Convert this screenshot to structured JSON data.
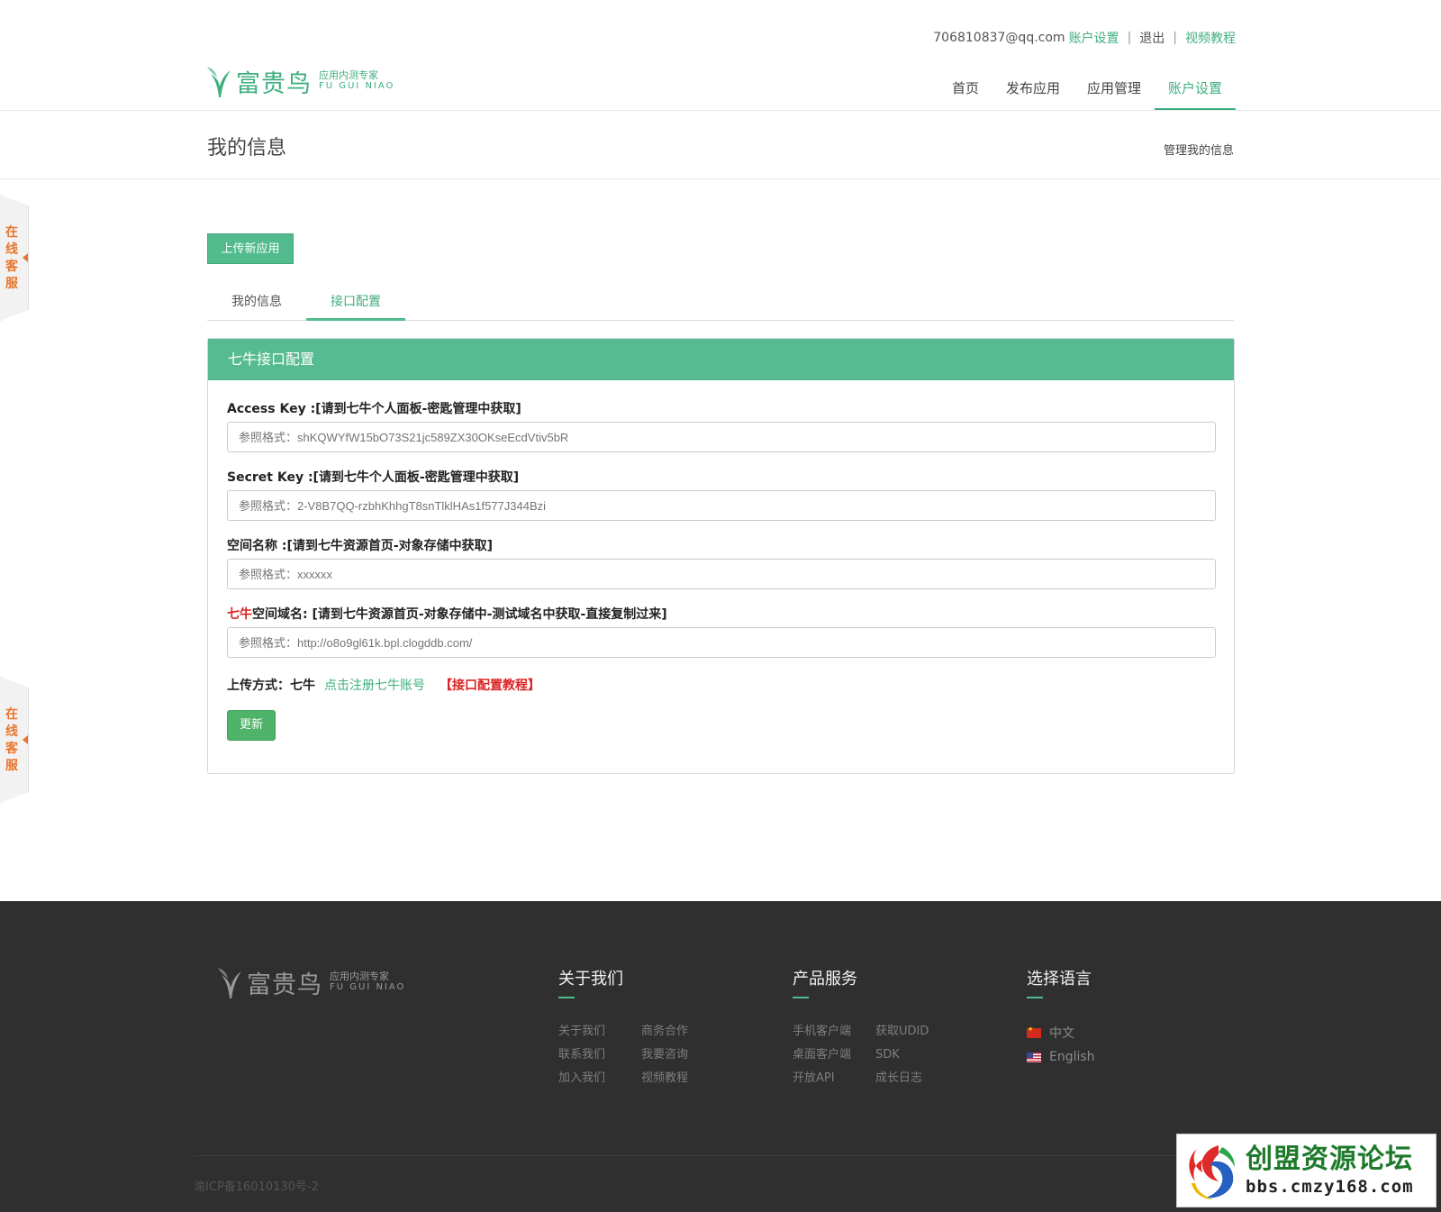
{
  "header": {
    "user_email": "706810837@qq.com",
    "account_settings_link": "账户设置",
    "logout_link": "退出",
    "video_tutorial_link": "视频教程",
    "separator": "|",
    "logo": {
      "name": "富贵鸟",
      "tagline_cn": "应用内测专家",
      "tagline_en": "FU GUI NIAO"
    },
    "nav": [
      "首页",
      "发布应用",
      "应用管理",
      "账户设置"
    ]
  },
  "page": {
    "title": "我的信息",
    "manage_link": "管理我的信息",
    "upload_button": "上传新应用",
    "tabs": [
      "我的信息",
      "接口配置"
    ],
    "active_tab": "接口配置"
  },
  "side_service": {
    "label": "在线客服"
  },
  "panel": {
    "title": "七牛接口配置",
    "fields": {
      "access_key": {
        "label": "Access Key :[请到七牛个人面板-密匙管理中获取]",
        "placeholder": "参照格式：shKQWYfW15bO73S21jc589ZX30OKseEcdVtiv5bR"
      },
      "secret_key": {
        "label": "Secret Key :[请到七牛个人面板-密匙管理中获取]",
        "placeholder": "参照格式：2-V8B7QQ-rzbhKhhgT8snTlklHAs1f577J344Bzi"
      },
      "bucket": {
        "label": "空间名称 :[请到七牛资源首页-对象存储中获取]",
        "placeholder": "参照格式：xxxxxx"
      },
      "domain": {
        "label_red": "七牛",
        "label_rest": "空间域名: [请到七牛资源首页-对象存储中-测试域名中获取-直接复制过来]",
        "placeholder": "参照格式：http://o8o9gl61k.bpl.clogddb.com/"
      }
    },
    "upload_method_label": "上传方式：七牛",
    "register_link": "点击注册七牛账号",
    "tutorial_link": "【接口配置教程】",
    "update_button": "更新"
  },
  "footer": {
    "logo": {
      "name": "富贵鸟",
      "tagline_cn": "应用内测专家",
      "tagline_en": "FU GUI NIAO"
    },
    "about": {
      "title": "关于我们",
      "links": [
        "关于我们",
        "商务合作",
        "联系我们",
        "我要咨询",
        "加入我们",
        "视频教程"
      ]
    },
    "products": {
      "title": "产品服务",
      "links": [
        "手机客户端",
        "获取UDID",
        "桌面客户端",
        "SDK",
        "开放API",
        "成长日志"
      ]
    },
    "language": {
      "title": "选择语言",
      "options": [
        "中文",
        "English"
      ]
    },
    "icp": "渝ICP备16010130号-2"
  },
  "watermark": {
    "title": "创盟资源论坛",
    "url": "bbs.cmzy168.com"
  },
  "colors": {
    "accent": "#52bb8e",
    "link_green": "#3fae7f",
    "footer_bg": "#2f2f2f",
    "warning_red": "#dd2222",
    "service_orange": "#e8752b"
  }
}
